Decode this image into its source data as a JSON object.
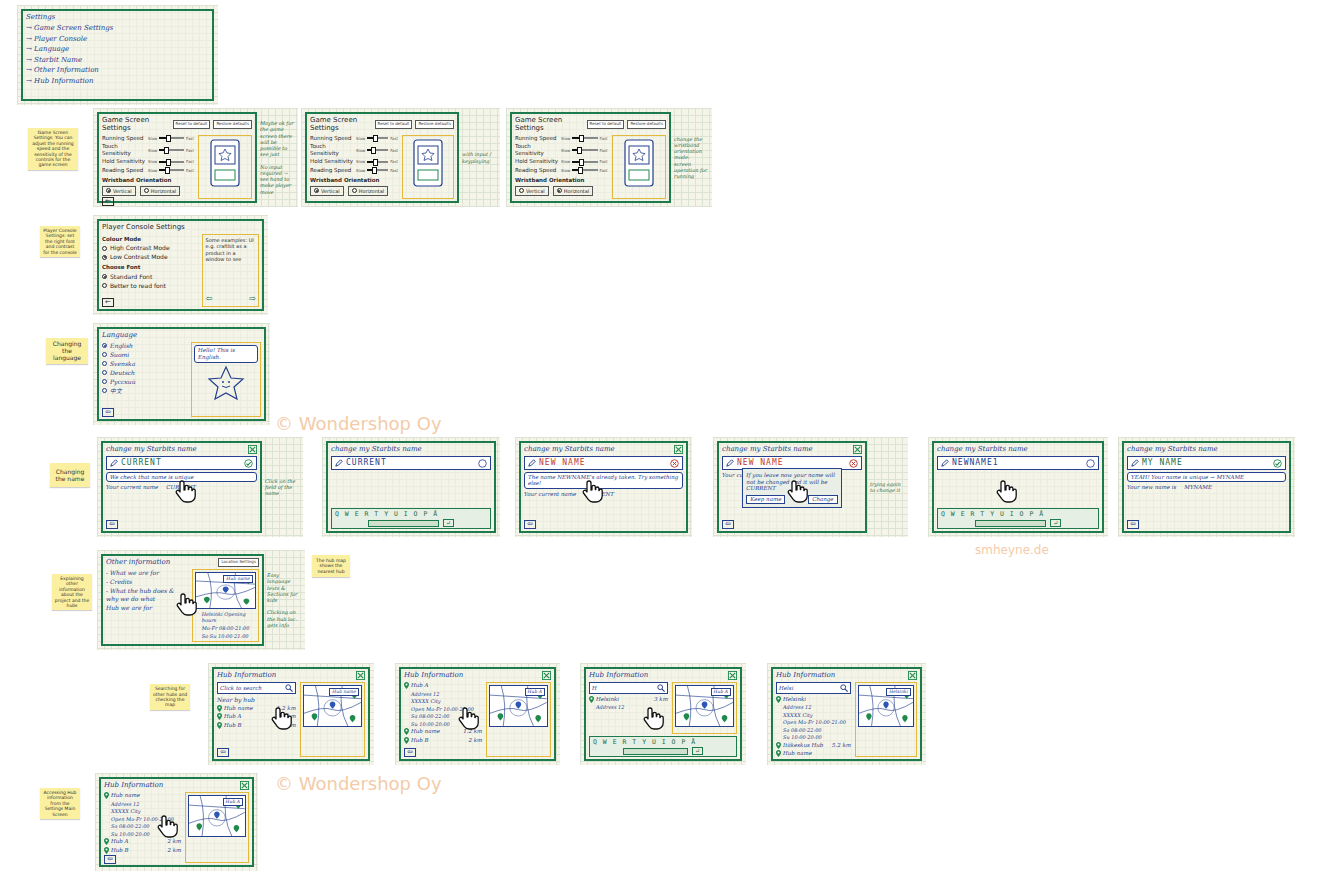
{
  "board": {
    "items": [
      {
        "kind": "frame-sketch",
        "title": "Settings",
        "buttons": [],
        "close": false,
        "pointer": false,
        "main": [
          {
            "kind": "link",
            "text": "→ Game Screen Settings"
          },
          {
            "kind": "link",
            "text": "→ Player Console"
          },
          {
            "kind": "link",
            "text": "→ Language"
          },
          {
            "kind": "link",
            "text": "→ Starbit Name"
          },
          {
            "kind": "link",
            "text": "→ Other Information"
          },
          {
            "kind": "link",
            "text": "→ Hub Information"
          }
        ],
        "side": [],
        "footer": [],
        "notes": []
      },
      {
        "kind": "sticky",
        "text": "Game Screen Settings: You can adjust the running speed and the sensitivity of the controls for the game screen"
      },
      {
        "kind": "frame-typed",
        "title": "Game Screen Settings",
        "buttons": [
          "Reset to default",
          "Restore defaults"
        ],
        "close": false,
        "pointer": false,
        "main": [
          {
            "kind": "slider",
            "label": "Running Speed",
            "min": "Slow",
            "max": "Fast",
            "level": 0.35
          },
          {
            "kind": "slider",
            "label": "Touch Sensitivity",
            "min": "Slow",
            "max": "Fast",
            "level": 0.25
          },
          {
            "kind": "slider",
            "label": "Hold Sensitivity",
            "min": "Slow",
            "max": "Fast",
            "level": 0.35
          },
          {
            "kind": "slider",
            "label": "Reading Speed",
            "min": "Slow",
            "max": "Fast",
            "level": 0.3
          },
          {
            "kind": "heading",
            "text": "Wristband Orientation"
          },
          {
            "kind": "radios",
            "options": [
              {
                "label": "Vertical",
                "selected": true
              },
              {
                "label": "Horizontal",
                "selected": false
              }
            ]
          },
          {
            "kind": "back",
            "text": "←"
          }
        ],
        "side": [
          {
            "kind": "phone"
          }
        ],
        "footer": [],
        "notes": [
          "Maybe ok for the game screen there will be possible to see just",
          "No input required → see hand to make player move"
        ]
      },
      {
        "kind": "frame-typed",
        "title": "Game Screen Settings",
        "buttons": [
          "Reset to default",
          "Restore defaults"
        ],
        "close": false,
        "pointer": false,
        "main": [
          {
            "kind": "slider",
            "label": "Running Speed",
            "min": "Slow",
            "max": "Fast",
            "level": 0.35
          },
          {
            "kind": "slider",
            "label": "Touch Sensitivity",
            "min": "Slow",
            "max": "Fast",
            "level": 0.25
          },
          {
            "kind": "slider",
            "label": "Hold Sensitivity",
            "min": "Slow",
            "max": "Fast",
            "level": 0.35
          },
          {
            "kind": "slider",
            "label": "Reading Speed",
            "min": "Slow",
            "max": "Fast",
            "level": 0.3
          },
          {
            "kind": "heading",
            "text": "Wristband Orientation"
          },
          {
            "kind": "radios",
            "options": [
              {
                "label": "Vertical",
                "selected": true
              },
              {
                "label": "Horizontal",
                "selected": false
              }
            ]
          }
        ],
        "side": [
          {
            "kind": "phone"
          }
        ],
        "footer": [],
        "notes": [
          "with input / keyplaying"
        ]
      },
      {
        "kind": "frame-typed",
        "title": "Game Screen Settings",
        "buttons": [
          "Reset to default",
          "Restore defaults"
        ],
        "close": false,
        "pointer": false,
        "main": [
          {
            "kind": "slider",
            "label": "Running Speed",
            "min": "Slow",
            "max": "Fast",
            "level": 0.35
          },
          {
            "kind": "slider",
            "label": "Touch Sensitivity",
            "min": "Slow",
            "max": "Fast",
            "level": 0.25
          },
          {
            "kind": "slider",
            "label": "Hold Sensitivity",
            "min": "Slow",
            "max": "Fast",
            "level": 0.35
          },
          {
            "kind": "slider",
            "label": "Reading Speed",
            "min": "Slow",
            "max": "Fast",
            "level": 0.3
          },
          {
            "kind": "heading",
            "text": "Wristband Orientation"
          },
          {
            "kind": "radios",
            "options": [
              {
                "label": "Vertical",
                "selected": false
              },
              {
                "label": "Horizontal",
                "selected": true
              }
            ]
          }
        ],
        "side": [
          {
            "kind": "phone"
          }
        ],
        "footer": [],
        "notes": [
          "change the wristband orientation mode: screen operation for running"
        ]
      },
      {
        "kind": "sticky",
        "text": "Player Console Settings: set the right font and contrast for the console"
      },
      {
        "kind": "frame-typed",
        "title": "Player Console Settings",
        "buttons": [],
        "close": false,
        "pointer": false,
        "main": [
          {
            "kind": "heading",
            "text": "Colour Mode"
          },
          {
            "kind": "radio",
            "label": "High Contrast Mode",
            "selected": false
          },
          {
            "kind": "radio",
            "label": "Low Contrast Mode",
            "selected": true
          },
          {
            "kind": "heading",
            "text": "Choose Font"
          },
          {
            "kind": "radio",
            "label": "Standard Font",
            "selected": true
          },
          {
            "kind": "radio",
            "label": "Better to read font",
            "selected": false
          },
          {
            "kind": "back",
            "text": "←"
          }
        ],
        "side": [
          {
            "kind": "text",
            "text": "Some examples: UI e.g. craftbit as a product in a window to see"
          },
          {
            "kind": "arrows",
            "left": "⇦",
            "right": "⇨"
          }
        ],
        "footer": [],
        "notes": []
      },
      {
        "kind": "sticky",
        "text": "Changing the language"
      },
      {
        "kind": "frame-sketch",
        "title": "Language",
        "buttons": [],
        "close": false,
        "pointer": false,
        "main": [
          {
            "kind": "radio",
            "label": "English",
            "selected": true
          },
          {
            "kind": "radio",
            "label": "Suomi",
            "selected": false
          },
          {
            "kind": "radio",
            "label": "Svenska",
            "selected": false
          },
          {
            "kind": "radio",
            "label": "Deutsch",
            "selected": false
          },
          {
            "kind": "radio",
            "label": "Русский",
            "selected": false
          },
          {
            "kind": "radio",
            "label": "中文",
            "selected": false
          },
          {
            "kind": "back",
            "text": "⇦"
          }
        ],
        "side": [
          {
            "kind": "bubble",
            "text": "Hello! This is English."
          },
          {
            "kind": "mascot"
          }
        ],
        "footer": [],
        "notes": []
      },
      {
        "kind": "sticky",
        "text": "Changing the name"
      },
      {
        "kind": "frame-sketch",
        "title": "change my Starbits name",
        "buttons": [],
        "close": true,
        "pointer": true,
        "main": [
          {
            "kind": "field",
            "text": "CURRENT",
            "status": "ok"
          },
          {
            "kind": "bubble",
            "text": "We check that name is unique"
          },
          {
            "kind": "label-row",
            "label": "Your current name",
            "value": "CURRENT"
          },
          {
            "kind": "back",
            "text": "⇦"
          }
        ],
        "side": [],
        "footer": [],
        "notes": [
          "Click on the field of the name"
        ]
      },
      {
        "kind": "frame-sketch",
        "title": "change my Starbits name",
        "buttons": [],
        "close": false,
        "pointer": false,
        "main": [
          {
            "kind": "field",
            "text": "CURRENT",
            "status": "none"
          }
        ],
        "side": [],
        "footer": [
          {
            "kind": "keyboard",
            "letters": "Q W E R T Y U I O P Å",
            "enter": "↵"
          }
        ],
        "notes": []
      },
      {
        "kind": "frame-sketch",
        "title": "change my Starbits name",
        "buttons": [],
        "close": true,
        "pointer": true,
        "main": [
          {
            "kind": "field",
            "text": "NEW NAME",
            "status": "error"
          },
          {
            "kind": "bubble",
            "text": "The name NEWNAME's already taken. Try something else!"
          },
          {
            "kind": "label-row",
            "label": "Your current name",
            "value": "CURRENT"
          },
          {
            "kind": "back",
            "text": "⇦"
          }
        ],
        "side": [],
        "footer": [],
        "notes": []
      },
      {
        "kind": "frame-sketch",
        "title": "change my Starbits name",
        "buttons": [],
        "close": true,
        "pointer": true,
        "main": [
          {
            "kind": "field",
            "text": "NEW NAME",
            "status": "error"
          },
          {
            "kind": "label-row",
            "label": "Your current name",
            "value": "CURRENT"
          },
          {
            "kind": "back",
            "text": "⇦"
          }
        ],
        "dialog": {
          "text": "If you leave now your name will not be changed and it will be CURRENT",
          "buttons": [
            "Keep name",
            "Change"
          ]
        },
        "side": [],
        "footer": [],
        "notes": [
          "trying again to change it"
        ]
      },
      {
        "kind": "frame-sketch",
        "title": "change my Starbits name",
        "buttons": [],
        "close": false,
        "pointer": true,
        "main": [
          {
            "kind": "field",
            "text": "NEWNAME1",
            "status": "none"
          }
        ],
        "side": [],
        "footer": [
          {
            "kind": "keyboard",
            "letters": "Q W E R T Y U I O P Å",
            "enter": "↵"
          }
        ],
        "notes": []
      },
      {
        "kind": "frame-sketch",
        "title": "change my Starbits name",
        "buttons": [],
        "close": false,
        "pointer": false,
        "main": [
          {
            "kind": "field",
            "text": "MY NAME",
            "status": "ok"
          },
          {
            "kind": "bubble",
            "text": "YEAH! Your name is unique → MYNAME"
          },
          {
            "kind": "label-row",
            "label": "Your new name is",
            "value": "MYNAME"
          },
          {
            "kind": "back",
            "text": "⇦"
          }
        ],
        "side": [],
        "footer": [],
        "notes": []
      },
      {
        "kind": "sticky",
        "text": "Explaining other information about the project and the hubs"
      },
      {
        "kind": "frame-sketch",
        "title": "Other information",
        "buttons": [
          "Location Settings"
        ],
        "close": false,
        "pointer": true,
        "main": [
          {
            "kind": "text",
            "text": "- What we are for"
          },
          {
            "kind": "text",
            "text": "- Credits"
          },
          {
            "kind": "text",
            "text": "- What the hub does & why we do what"
          },
          {
            "kind": "text",
            "text": "Hub we are for"
          }
        ],
        "side": [
          {
            "kind": "map",
            "label": "Hub name"
          },
          {
            "kind": "detail",
            "text": "Helsinki Opening hours"
          },
          {
            "kind": "detail",
            "text": "Mo-Fr 08:00-21:00"
          },
          {
            "kind": "detail",
            "text": "Sa-Su 10:00-21:00"
          }
        ],
        "footer": [],
        "notes": [
          "Easy language texts & Sections for kids",
          "Clicking on the hub loc. gets info"
        ]
      },
      {
        "kind": "sticky",
        "text": "The hub map shows the nearest hub"
      },
      {
        "kind": "sticky",
        "text": "Searching for other hubs and checking the map"
      },
      {
        "kind": "frame-sketch",
        "title": "Hub Information",
        "buttons": [],
        "close": true,
        "pointer": true,
        "main": [
          {
            "kind": "search",
            "text": "Click to search"
          },
          {
            "kind": "text",
            "text": "Near by hub"
          },
          {
            "kind": "pin",
            "text": "Hub name",
            "dist": "1.2 km"
          },
          {
            "kind": "pin",
            "text": "Hub A",
            "dist": "2 km"
          },
          {
            "kind": "pin",
            "text": "Hub B",
            "dist": "2.5 km"
          },
          {
            "kind": "back",
            "text": "⇦"
          }
        ],
        "side": [
          {
            "kind": "map",
            "label": "Hub name"
          }
        ],
        "footer": [],
        "notes": []
      },
      {
        "kind": "frame-sketch",
        "title": "Hub Information",
        "buttons": [],
        "close": true,
        "pointer": true,
        "main": [
          {
            "kind": "pin",
            "text": "Hub A"
          },
          {
            "kind": "detail",
            "text": "Address 12"
          },
          {
            "kind": "detail",
            "text": "XXXXX City"
          },
          {
            "kind": "detail",
            "text": "Open Mo-Fr 10:00-21:00"
          },
          {
            "kind": "detail",
            "text": "Sa 08:00-22:00"
          },
          {
            "kind": "detail",
            "text": "Su 10:00-20:00"
          },
          {
            "kind": "pin",
            "text": "Hub name",
            "dist": "1.2 km"
          },
          {
            "kind": "pin",
            "text": "Hub B",
            "dist": "2 km"
          },
          {
            "kind": "back",
            "text": "⇦"
          }
        ],
        "side": [
          {
            "kind": "map",
            "label": "Hub A"
          }
        ],
        "footer": [],
        "notes": []
      },
      {
        "kind": "frame-sketch",
        "title": "Hub Information",
        "buttons": [],
        "close": true,
        "pointer": true,
        "main": [
          {
            "kind": "search",
            "text": "H"
          },
          {
            "kind": "pin",
            "text": "Helsinki",
            "dist": "3 km"
          },
          {
            "kind": "detail",
            "text": "Address 12"
          }
        ],
        "side": [
          {
            "kind": "map",
            "label": "Hub A"
          }
        ],
        "footer": [
          {
            "kind": "keyboard",
            "letters": "Q W E R T Y U I O P Å",
            "enter": "↵"
          }
        ],
        "notes": []
      },
      {
        "kind": "frame-sketch",
        "title": "Hub Information",
        "buttons": [],
        "close": true,
        "pointer": false,
        "main": [
          {
            "kind": "search",
            "text": "Helsi"
          },
          {
            "kind": "pin",
            "text": "Helsinki"
          },
          {
            "kind": "detail",
            "text": "Address 12"
          },
          {
            "kind": "detail",
            "text": "XXXXX City"
          },
          {
            "kind": "detail",
            "text": "Open Mo-Fr 10:00-21:00"
          },
          {
            "kind": "detail",
            "text": "Sa 08:00-22:00"
          },
          {
            "kind": "detail",
            "text": "Su 10:00-20:00"
          },
          {
            "kind": "pin",
            "text": "Itäkeskus Hub",
            "dist": "5.2 km"
          },
          {
            "kind": "pin",
            "text": "Hub name"
          }
        ],
        "side": [
          {
            "kind": "map",
            "label": "Helsinki"
          }
        ],
        "footer": [],
        "notes": []
      },
      {
        "kind": "sticky",
        "text": "Accessing Hub information from the Settings Main Screen"
      },
      {
        "kind": "frame-sketch",
        "title": "Hub Information",
        "buttons": [],
        "close": true,
        "pointer": true,
        "main": [
          {
            "kind": "pin",
            "text": "Hub name"
          },
          {
            "kind": "detail",
            "text": "Address 12"
          },
          {
            "kind": "detail",
            "text": "XXXXX City"
          },
          {
            "kind": "detail",
            "text": "Open Mo-Fr 10:00-21:00"
          },
          {
            "kind": "detail",
            "text": "Sa 08:00-22:00"
          },
          {
            "kind": "detail",
            "text": "Su 10:00-20:00"
          },
          {
            "kind": "pin",
            "text": "Hub A",
            "dist": "2 km"
          },
          {
            "kind": "pin",
            "text": "Hub B",
            "dist": "2 km"
          },
          {
            "kind": "back",
            "text": "⇦"
          }
        ],
        "side": [
          {
            "kind": "map",
            "label": "Hub A"
          }
        ],
        "footer": [],
        "notes": []
      }
    ]
  },
  "watermarks": [
    {
      "text": "© Wondershop Oy"
    },
    {
      "text": "© Wondershop Oy"
    },
    {
      "text": "smheyne.de"
    }
  ]
}
